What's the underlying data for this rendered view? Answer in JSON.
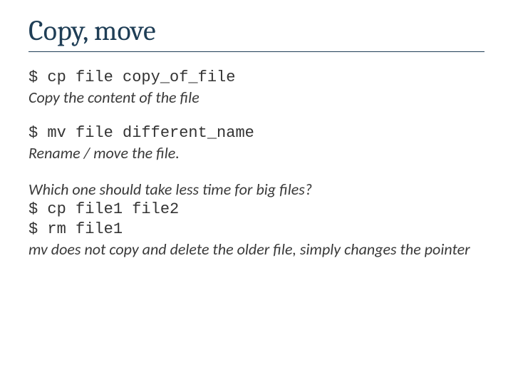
{
  "title": "Copy, move",
  "block1": {
    "cmd": "$ cp file copy_of_file",
    "desc": "Copy the content of the file"
  },
  "block2": {
    "cmd": "$ mv file different_name",
    "desc": "Rename  / move the file."
  },
  "block3": {
    "q": "Which one should take less time for big files?",
    "cmd1": "$ cp file1 file2",
    "cmd2": "$ rm file1",
    "ans": "mv does not copy and delete the older file, simply changes the pointer"
  }
}
